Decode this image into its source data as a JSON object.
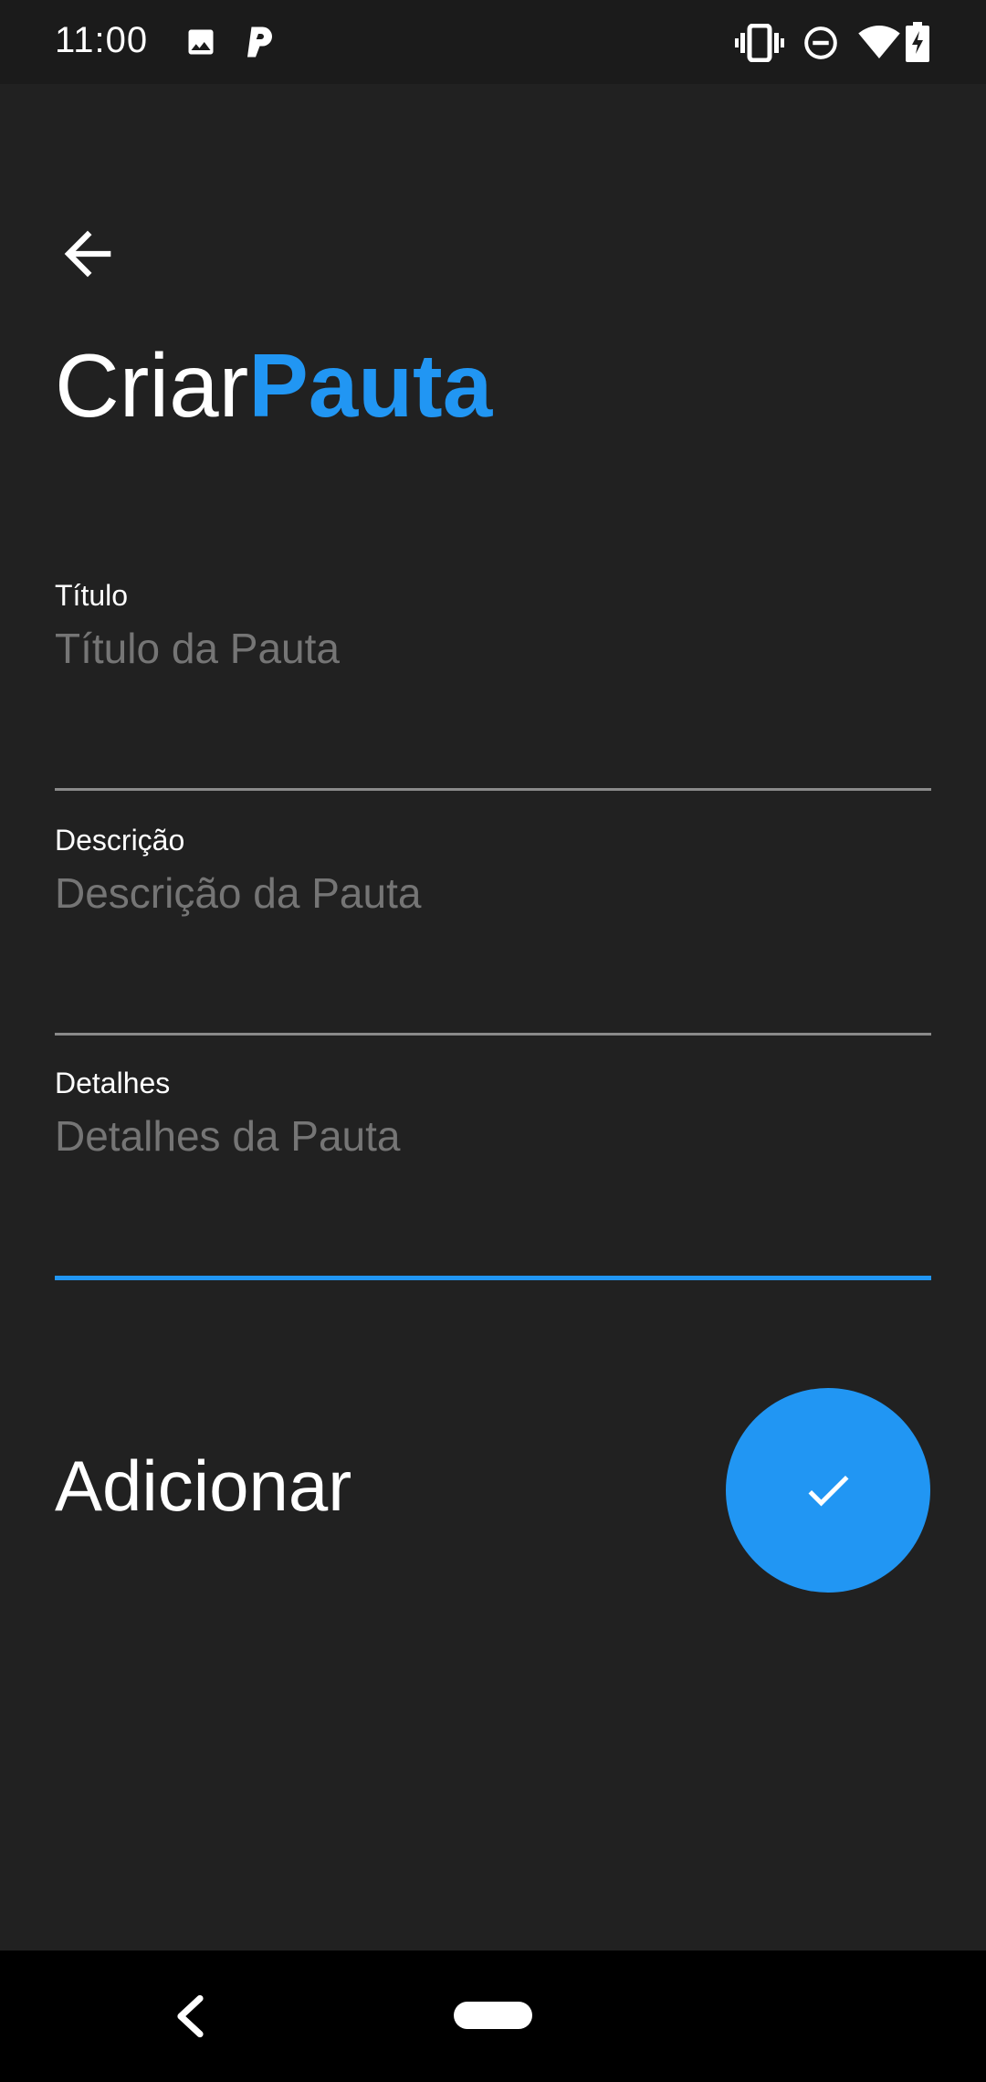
{
  "status_bar": {
    "time": "11:00",
    "icons": [
      "image-icon",
      "parking-icon",
      "vibrate-icon",
      "do-not-disturb-icon",
      "wifi-icon",
      "battery-charging-icon"
    ]
  },
  "header": {
    "back_icon": "arrow-left-icon",
    "title_part1": "Criar",
    "title_part2": "Pauta"
  },
  "form": {
    "fields": [
      {
        "label": "Título",
        "placeholder": "Título da Pauta",
        "value": ""
      },
      {
        "label": "Descrição",
        "placeholder": "Descrição da Pauta",
        "value": ""
      },
      {
        "label": "Detalhes",
        "placeholder": "Detalhes da Pauta",
        "value": ""
      }
    ],
    "add_label": "Adicionar",
    "submit_icon": "check-icon"
  },
  "nav_bar": {
    "back_icon": "nav-back-icon",
    "home_icon": "nav-home-pill"
  },
  "colors": {
    "background": "#212121",
    "accent": "#2196f3",
    "text": "#ffffff"
  }
}
